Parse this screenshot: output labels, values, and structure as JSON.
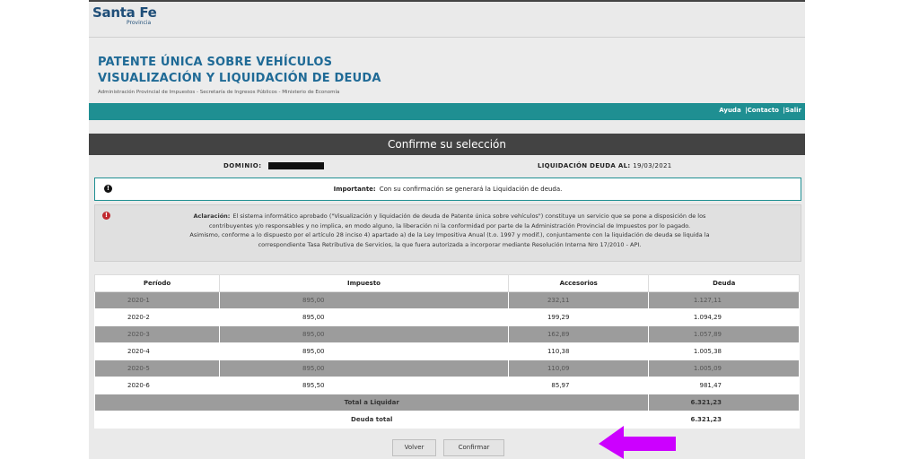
{
  "logo": {
    "main": "Santa Fe",
    "sub": "Provincia"
  },
  "header": {
    "title_line1": "PATENTE ÚNICA SOBRE VEHÍCULOS",
    "title_line2": "VISUALIZACIÓN Y LIQUIDACIÓN DE DEUDA",
    "subtitle": "Administración Provincial de Impuestos - Secretaría de Ingresos Públicos - Ministerio de Economía"
  },
  "nav": {
    "ayuda": "Ayuda",
    "contacto": "|Contacto",
    "salir": "|Salir"
  },
  "panel": {
    "title": "Confirme su selección"
  },
  "info": {
    "dominio_label": "DOMINIO:",
    "liquidacion_label": "LIQUIDACIÓN DEUDA AL:",
    "liquidacion_date": "19/03/2021"
  },
  "important": {
    "icon": "!",
    "label": "Importante:",
    "text": "Con su confirmación se generará la Liquidación de deuda."
  },
  "aclaracion": {
    "icon": "!",
    "label": "Aclaración:",
    "line1": "El sistema informático aprobado (\"Visualización y liquidación de deuda de Patente única sobre vehículos\") constituye un servicio que se pone a disposición de los",
    "line2": "contribuyentes y/o responsables y no implica, en modo alguno, la liberación ni la conformidad por parte de la Administración Provincial de Impuestos por lo pagado.",
    "line3": "Asimismo, conforme a lo dispuesto por el artículo 28 inciso 4) apartado a) de la Ley Impositiva Anual (t.o. 1997 y modif.), conjuntamente con la liquidación de deuda se liquida la",
    "line4": "correspondiente Tasa Retributiva de Servicios, la que fuera autorizada a incorporar mediante Resolución Interna Nro 17/2010 - API."
  },
  "table": {
    "headers": [
      "Período",
      "Impuesto",
      "Accesorios",
      "Deuda"
    ],
    "rows": [
      {
        "periodo": "2020-1",
        "impuesto": "895,00",
        "accesorios": "232,11",
        "deuda": "1.127,11"
      },
      {
        "periodo": "2020-2",
        "impuesto": "895,00",
        "accesorios": "199,29",
        "deuda": "1.094,29"
      },
      {
        "periodo": "2020-3",
        "impuesto": "895,00",
        "accesorios": "162,89",
        "deuda": "1.057,89"
      },
      {
        "periodo": "2020-4",
        "impuesto": "895,00",
        "accesorios": "110,38",
        "deuda": "1.005,38"
      },
      {
        "periodo": "2020-5",
        "impuesto": "895,00",
        "accesorios": "110,09",
        "deuda": "1.005,09"
      },
      {
        "periodo": "2020-6",
        "impuesto": "895,50",
        "accesorios": "85,97",
        "deuda": "981,47"
      }
    ],
    "total_liquidar_label": "Total a Liquidar",
    "total_liquidar_value": "6.321,23",
    "deuda_total_label": "Deuda total",
    "deuda_total_value": "6.321,23"
  },
  "buttons": {
    "volver": "Volver",
    "confirmar": "Confirmar"
  },
  "colors": {
    "teal": "#1f8f92",
    "dark_header": "#434343",
    "arrow": "#cc00ff",
    "title_blue": "#1f6a96"
  }
}
